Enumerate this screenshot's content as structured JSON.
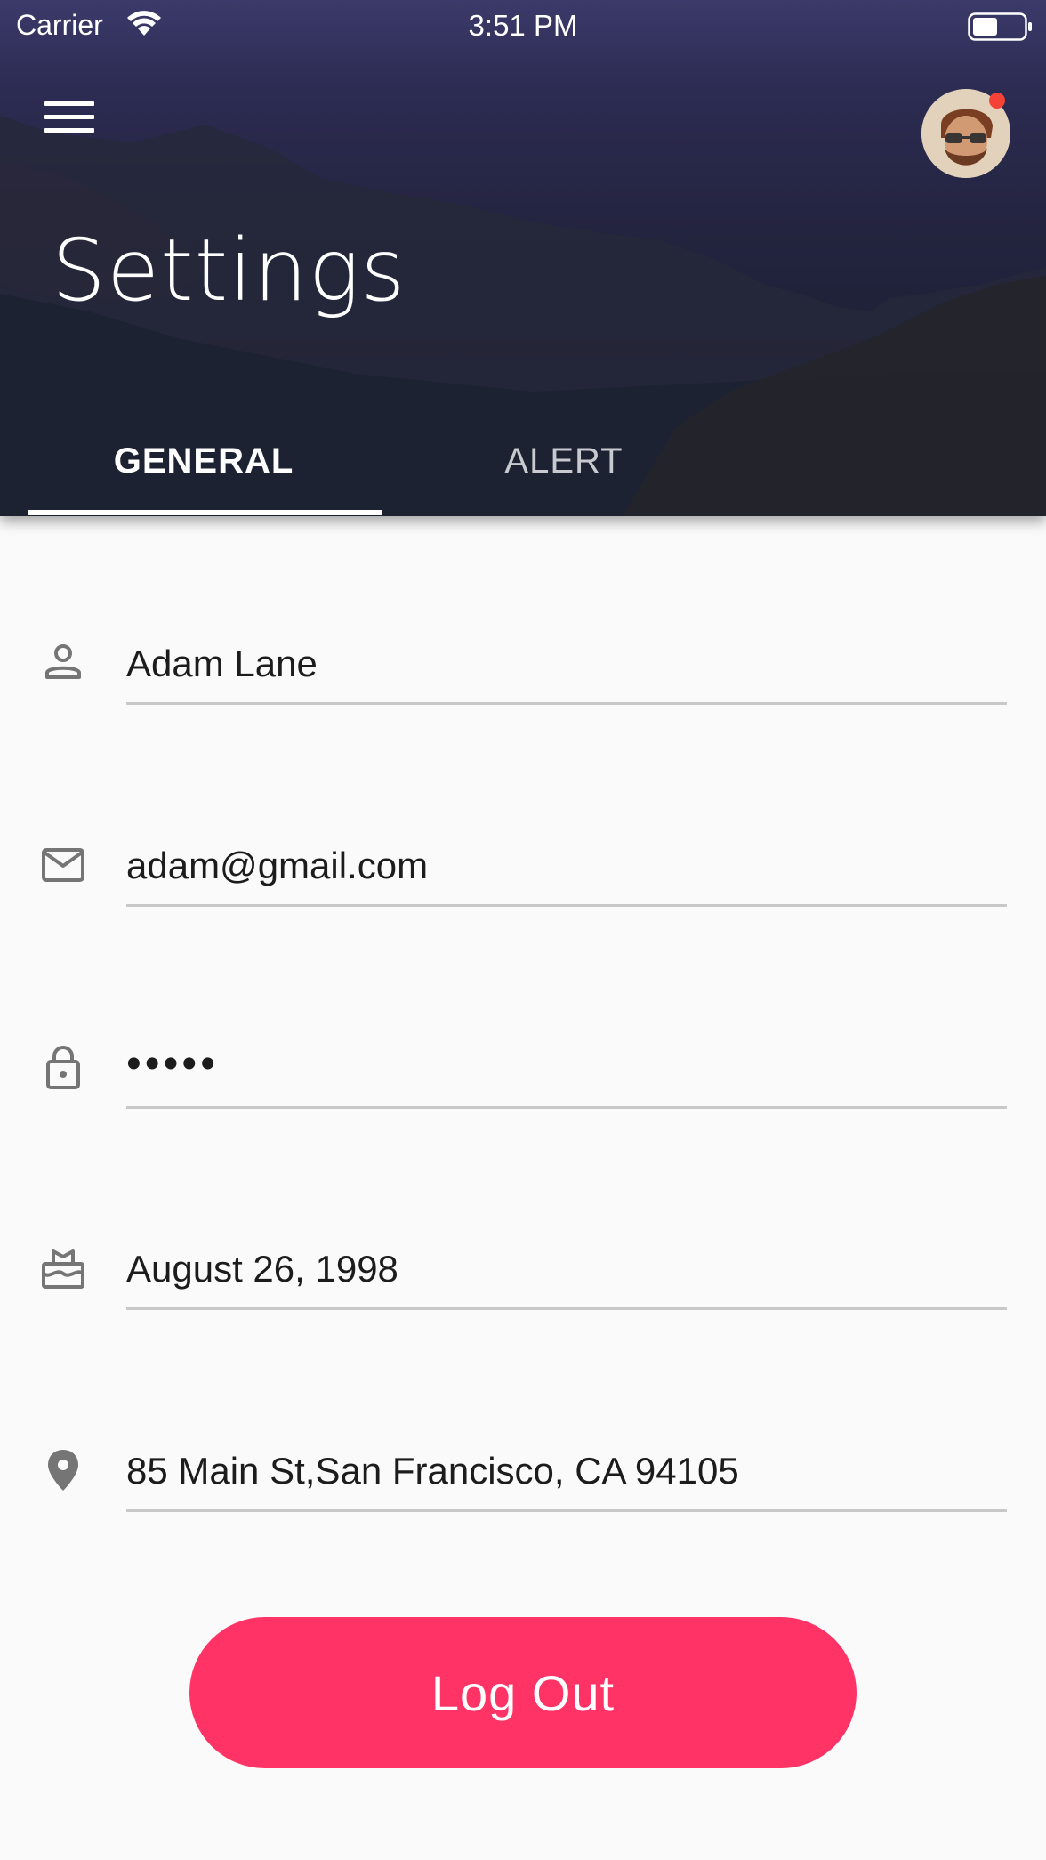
{
  "status_bar": {
    "carrier": "Carrier",
    "time": "3:51 PM"
  },
  "header": {
    "title": "Settings",
    "tabs": [
      {
        "label": "GENERAL",
        "selected": true
      },
      {
        "label": "ALERT",
        "selected": false
      }
    ]
  },
  "fields": [
    {
      "icon": "person-icon",
      "value": "Adam Lane"
    },
    {
      "icon": "mail-icon",
      "value": "adam@gmail.com"
    },
    {
      "icon": "lock-icon",
      "value": "•••••"
    },
    {
      "icon": "cake-icon",
      "value": "August 26, 1998"
    },
    {
      "icon": "location-pin-icon",
      "value": "85 Main St,San Francisco, CA 94105"
    }
  ],
  "logout_label": "Log Out",
  "colors": {
    "accent": "#ff3366",
    "header_dark": "#1e2036",
    "underline": "#c8c8c8",
    "icon_gray": "#757575",
    "notification": "#f44336"
  }
}
